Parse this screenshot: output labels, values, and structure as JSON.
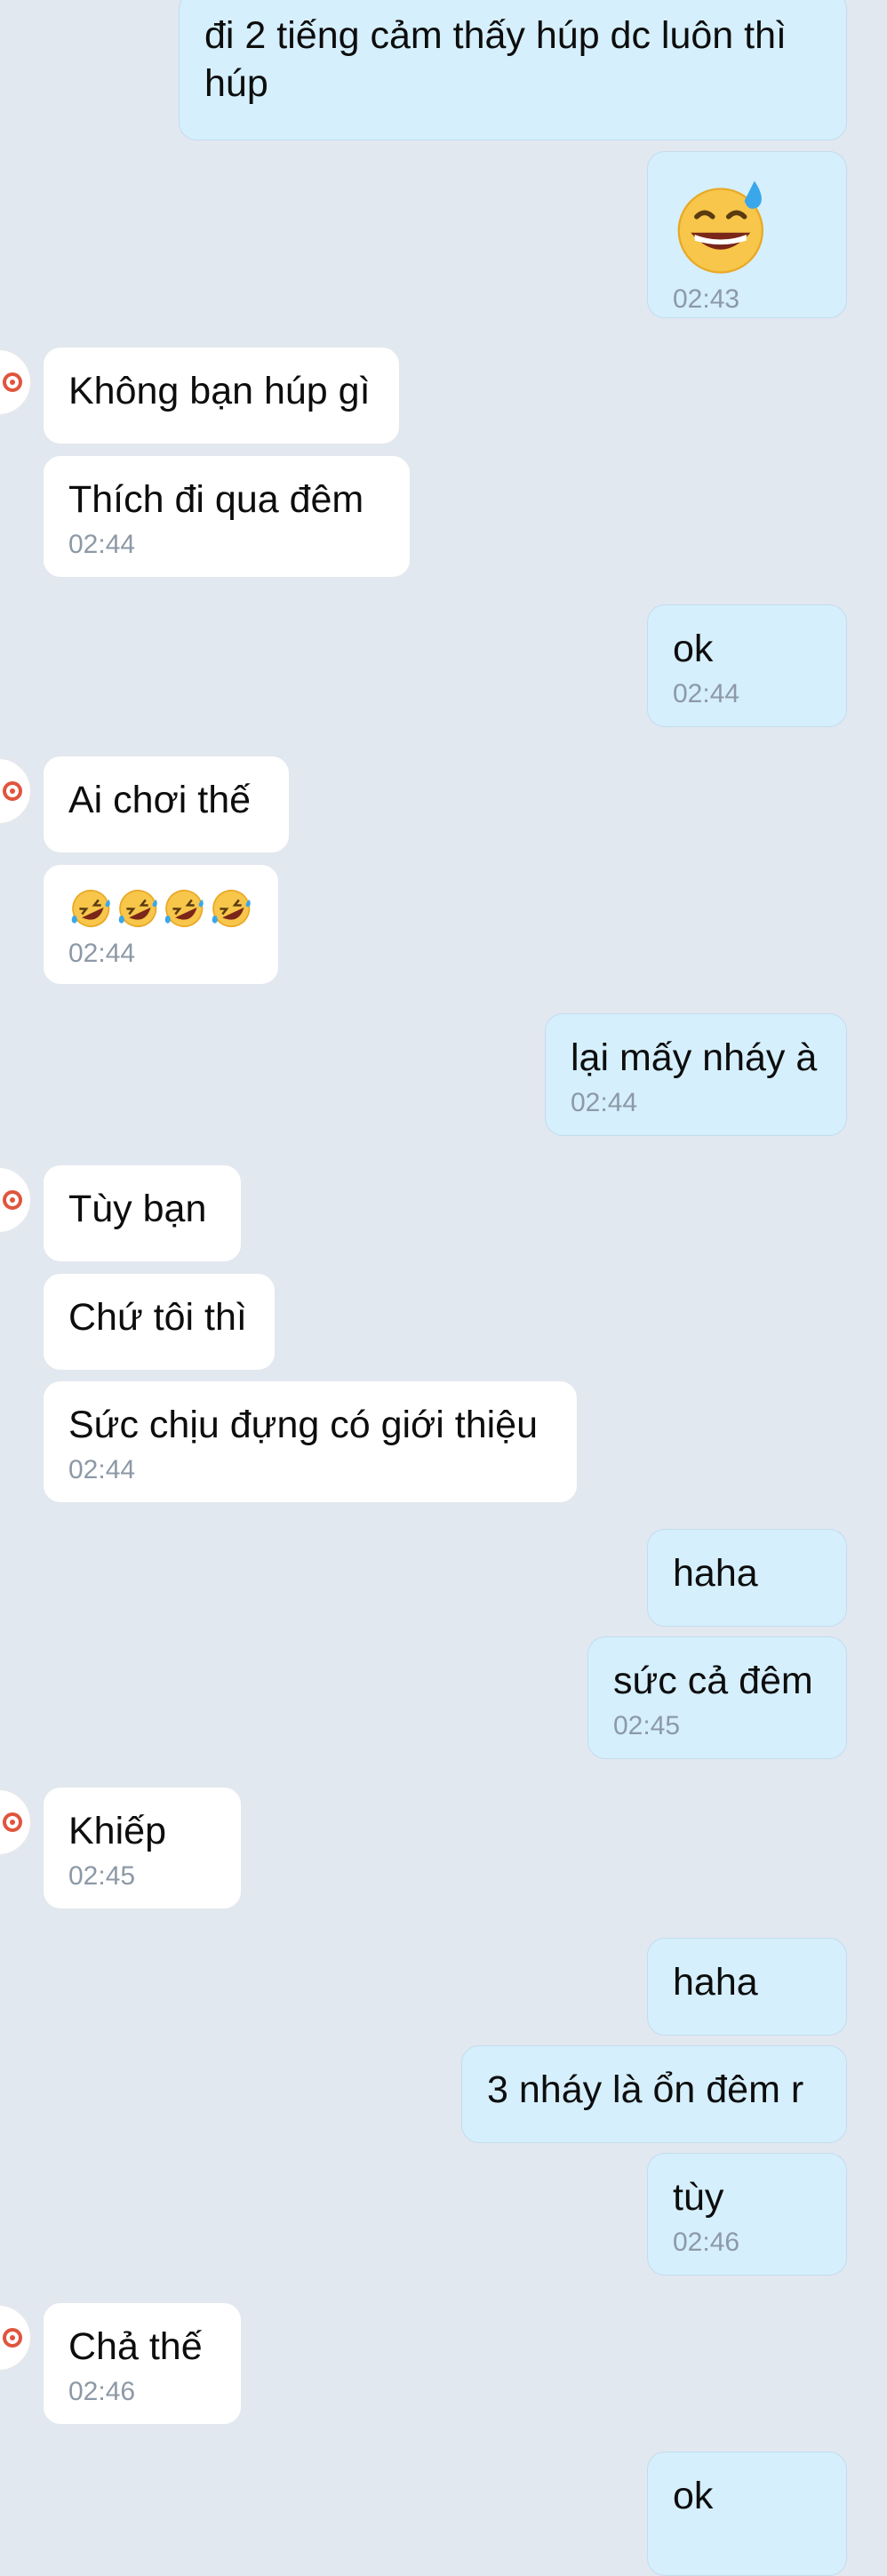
{
  "messages": [
    {
      "id": "m1",
      "dir": "out",
      "text": "đi 2 tiếng cảm thấy húp dc luôn thì\nhúp",
      "time": ""
    },
    {
      "id": "m2",
      "dir": "out",
      "text": "",
      "emoji": "grinning-sweat-emoji",
      "time": "02:43"
    },
    {
      "id": "m3",
      "dir": "in",
      "text": "Không bạn húp gì",
      "time": ""
    },
    {
      "id": "m4",
      "dir": "in",
      "text": "Thích đi qua đêm",
      "time": "02:44"
    },
    {
      "id": "m5",
      "dir": "out",
      "text": "ok",
      "time": "02:44"
    },
    {
      "id": "m6",
      "dir": "in",
      "text": "Ai chơi thế",
      "time": ""
    },
    {
      "id": "m7",
      "dir": "in",
      "text": "",
      "emoji": "rofl-emoji x4",
      "time": "02:44"
    },
    {
      "id": "m8",
      "dir": "out",
      "text": "lại mấy nháy à",
      "time": "02:44"
    },
    {
      "id": "m9",
      "dir": "in",
      "text": "Tùy bạn",
      "time": ""
    },
    {
      "id": "m10",
      "dir": "in",
      "text": "Chứ tôi thì",
      "time": ""
    },
    {
      "id": "m11",
      "dir": "in",
      "text": "Sức chịu đựng có giới thiệu",
      "time": "02:44"
    },
    {
      "id": "m12",
      "dir": "out",
      "text": "haha",
      "time": ""
    },
    {
      "id": "m13",
      "dir": "out",
      "text": "sức cả đêm",
      "time": "02:45"
    },
    {
      "id": "m14",
      "dir": "in",
      "text": "Khiếp",
      "time": "02:45"
    },
    {
      "id": "m15",
      "dir": "out",
      "text": "haha",
      "time": ""
    },
    {
      "id": "m16",
      "dir": "out",
      "text": "3 nháy là ổn đêm r",
      "time": ""
    },
    {
      "id": "m17",
      "dir": "out",
      "text": "tùy",
      "time": "02:46"
    },
    {
      "id": "m18",
      "dir": "in",
      "text": "Chả thế",
      "time": "02:46"
    },
    {
      "id": "m19",
      "dir": "out",
      "text": "ok",
      "time": ""
    }
  ],
  "colors": {
    "background": "#e2e8f0",
    "outgoing_bubble": "#d5effc",
    "incoming_bubble": "#ffffff",
    "timestamp": "#8d99a6"
  },
  "icons": {
    "avatar": "avatar",
    "sweat_emoji": "grinning-face-with-sweat",
    "rofl_emoji": "rolling-on-the-floor-laughing"
  }
}
